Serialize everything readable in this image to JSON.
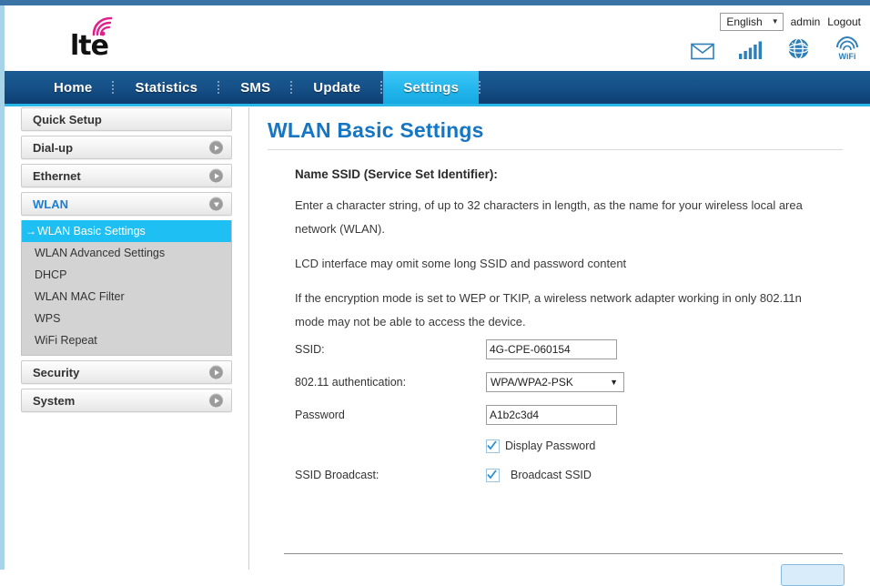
{
  "header": {
    "logo_text": "lte",
    "logo_sub": "",
    "language": "English",
    "language_caret": "▼",
    "user": "admin",
    "logout": "Logout",
    "icons": [
      {
        "name": "mail-icon"
      },
      {
        "name": "signal-bars-icon"
      },
      {
        "name": "globe-icon"
      },
      {
        "name": "wifi-icon"
      }
    ]
  },
  "nav": {
    "items": [
      {
        "label": "Home",
        "active": false
      },
      {
        "label": "Statistics",
        "active": false
      },
      {
        "label": "SMS",
        "active": false
      },
      {
        "label": "Update",
        "active": false
      },
      {
        "label": "Settings",
        "active": true
      }
    ]
  },
  "sidebar": {
    "items": [
      {
        "label": "Quick Setup",
        "arrow": "none",
        "open": false
      },
      {
        "label": "Dial-up",
        "arrow": "right",
        "open": false
      },
      {
        "label": "Ethernet",
        "arrow": "right",
        "open": false
      },
      {
        "label": "WLAN",
        "arrow": "down",
        "open": true
      },
      {
        "label": "Security",
        "arrow": "right",
        "open": false
      },
      {
        "label": "System",
        "arrow": "right",
        "open": false
      }
    ],
    "submenu": [
      {
        "label": "WLAN Basic Settings",
        "active": true,
        "arrow": "→"
      },
      {
        "label": "WLAN Advanced Settings",
        "active": false,
        "arrow": ""
      },
      {
        "label": "DHCP",
        "active": false,
        "arrow": ""
      },
      {
        "label": "WLAN MAC Filter",
        "active": false,
        "arrow": ""
      },
      {
        "label": "WPS",
        "active": false,
        "arrow": ""
      },
      {
        "label": "WiFi Repeat",
        "active": false,
        "arrow": ""
      }
    ]
  },
  "main": {
    "title": "WLAN Basic Settings",
    "section_heading": "Name SSID (Service Set Identifier):",
    "paragraphs": [
      "Enter a character string, of up to 32 characters in length, as the name for your wireless local area network (WLAN).",
      "LCD interface may omit some long SSID and password content",
      "If the encryption mode is set to WEP or TKIP, a wireless network adapter working in only 802.11n mode may not be able to access the device."
    ],
    "fields": {
      "ssid_label": "SSID:",
      "ssid_value": "4G-CPE-060154",
      "auth_label": "802.11 authentication:",
      "auth_value": "WPA/WPA2-PSK",
      "auth_caret": "▼",
      "password_label": "Password",
      "password_value": "A1b2c3d4",
      "display_password_label": "Display Password",
      "display_password_checked": true,
      "ssid_broadcast_label": "SSID Broadcast:",
      "broadcast_ssid_label": "Broadcast SSID",
      "broadcast_ssid_checked": true
    },
    "apply_label": ""
  },
  "colors": {
    "accent_blue": "#1676c4",
    "nav_dark": "#17528a",
    "nav_active": "#22b6ec",
    "highlight_cyan": "#1ec0f3",
    "logo_pink": "#e0218a"
  }
}
